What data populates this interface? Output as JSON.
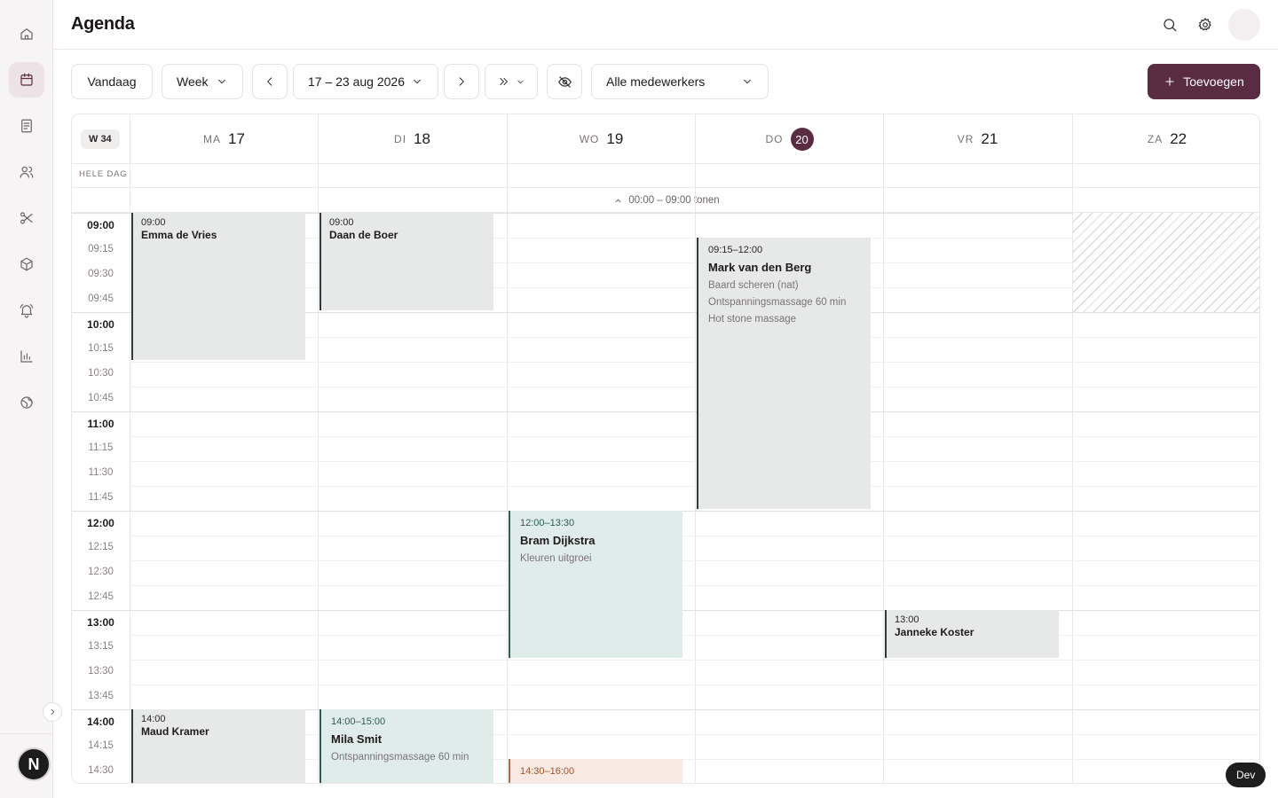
{
  "header": {
    "title": "Agenda"
  },
  "toolbar": {
    "today_label": "Vandaag",
    "view_label": "Week",
    "date_range": "17 – 23 aug 2026",
    "staff_filter": "Alle medewerkers",
    "add_label": "Toevoegen"
  },
  "calendar": {
    "week_badge": "W 34",
    "all_day_label": "HELE DAG",
    "show_earlier_label": "00:00 – 09:00 tonen",
    "today_index": 3,
    "days": [
      {
        "abbr": "MA",
        "num": "17"
      },
      {
        "abbr": "DI",
        "num": "18"
      },
      {
        "abbr": "WO",
        "num": "19"
      },
      {
        "abbr": "DO",
        "num": "20"
      },
      {
        "abbr": "VR",
        "num": "21"
      },
      {
        "abbr": "ZA",
        "num": "22"
      }
    ],
    "time_labels": [
      "09:00",
      "09:15",
      "09:30",
      "09:45",
      "10:00",
      "10:15",
      "10:30",
      "10:45",
      "11:00",
      "11:15",
      "11:30",
      "11:45",
      "12:00",
      "12:15",
      "12:30",
      "12:45",
      "13:00",
      "13:15",
      "13:30",
      "13:45",
      "14:00",
      "14:15",
      "14:30"
    ],
    "blocked_slots": [
      {
        "day": 5,
        "start": "09:00",
        "end": "10:00"
      }
    ],
    "events": [
      {
        "day": 0,
        "start": "09:00",
        "end": "10:30",
        "time_text": "09:00",
        "name": "Emma de Vries",
        "services": [],
        "color": "grey"
      },
      {
        "day": 1,
        "start": "09:00",
        "end": "10:00",
        "time_text": "09:00",
        "name": "Daan de Boer",
        "services": [],
        "color": "grey"
      },
      {
        "day": 3,
        "start": "09:15",
        "end": "12:00",
        "time_text": "09:15–12:00",
        "name": "Mark van den Berg",
        "services": [
          "Baard scheren (nat)",
          "Ontspanningsmassage 60 min",
          "Hot stone massage"
        ],
        "color": "grey"
      },
      {
        "day": 2,
        "start": "12:00",
        "end": "13:30",
        "time_text": "12:00–13:30",
        "name": "Bram Dijkstra",
        "services": [
          "Kleuren uitgroei"
        ],
        "color": "teal"
      },
      {
        "day": 4,
        "start": "13:00",
        "end": "13:30",
        "time_text": "13:00",
        "name": "Janneke Koster",
        "services": [],
        "color": "grey"
      },
      {
        "day": 0,
        "start": "14:00",
        "end": "15:00",
        "time_text": "14:00",
        "name": "Maud Kramer",
        "services": [],
        "color": "grey"
      },
      {
        "day": 1,
        "start": "14:00",
        "end": "15:00",
        "time_text": "14:00–15:00",
        "name": "Mila Smit",
        "services": [
          "Ontspanningsmassage 60 min"
        ],
        "color": "teal"
      },
      {
        "day": 2,
        "start": "14:30",
        "end": "16:00",
        "time_text": "14:30–16:00",
        "name": "",
        "services": [],
        "color": "peach"
      }
    ]
  },
  "env_badge": "Dev",
  "user_initial": "N",
  "icons": {
    "sidebar": [
      "home-icon",
      "calendar-icon",
      "document-icon",
      "users-icon",
      "scissors-icon",
      "box-icon",
      "bell-icon",
      "bar-chart-icon",
      "globe-icon"
    ],
    "top": [
      "search-icon",
      "gear-icon"
    ]
  },
  "colors": {
    "accent": "#5a2c43",
    "event_grey": "#e7e8e8",
    "event_teal": "#e0ecea",
    "event_peach": "#f8e9e2"
  }
}
